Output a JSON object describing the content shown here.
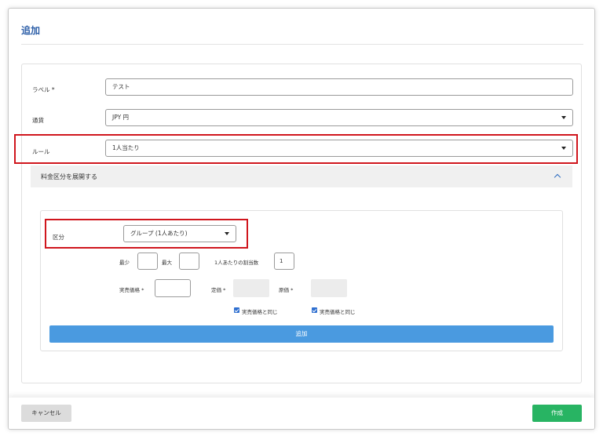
{
  "modal": {
    "title": "追加"
  },
  "form": {
    "label": {
      "label": "ラベル *",
      "value": "テスト"
    },
    "currency": {
      "label": "通貨",
      "value": "JPY 円"
    },
    "rule": {
      "label": "ルール",
      "value": "1人当たり"
    }
  },
  "accordion": {
    "label": "料金区分を展開する"
  },
  "tier": {
    "section": {
      "label": "区分",
      "value": "グループ (1人あたり)"
    },
    "min_label": "最少",
    "min_value": "",
    "max_label": "最大",
    "max_value": "",
    "per_unit_label": "1人あたりの割当数",
    "per_unit_value": "1",
    "sale_price_label": "実売価格 *",
    "sale_price_value": "",
    "list_price_label": "定価 *",
    "cost_price_label": "原価 *",
    "same_as_sale_1": "実売価格と同じ",
    "same_as_sale_2": "実売価格と同じ",
    "add_button": "追加"
  },
  "footer": {
    "cancel": "キャンセル",
    "create": "作成"
  },
  "colors": {
    "title": "#2d5fa8",
    "highlight": "#d0161d",
    "primary": "#4a9ae0",
    "success": "#28b463",
    "checkbox": "#2f6fd0"
  }
}
